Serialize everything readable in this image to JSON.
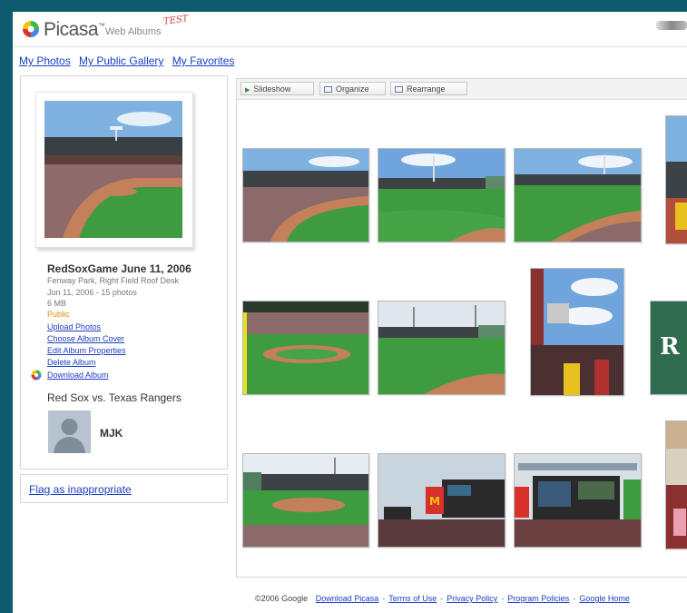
{
  "header": {
    "brand": "Picasa",
    "brand_tm": "™",
    "brand_sub": "Web Albums",
    "badge": "TEST"
  },
  "nav": {
    "my_photos": "My Photos",
    "my_public_gallery": "My Public Gallery",
    "my_favorites": "My Favorites"
  },
  "album": {
    "title": "RedSoxGame June 11, 2006",
    "location": "Fenway Park, Right Field Roof Desk",
    "date_count": "Jun 11, 2006 - 15 photos",
    "size": "6 MB",
    "visibility": "Public",
    "actions": {
      "upload": "Upload Photos",
      "choose_cover": "Choose Album Cover",
      "edit_properties": "Edit Album Properties",
      "delete": "Delete Album",
      "download": "Download Album"
    },
    "description": "Red Sox vs. Texas Rangers",
    "owner": "MJK"
  },
  "flag": {
    "label": "Flag as inappropriate"
  },
  "toolbar": {
    "slideshow": "Slideshow",
    "organize": "Organize",
    "rearrange": "Rearrange"
  },
  "footer": {
    "copyright": "©2006 Google",
    "links": [
      "Download Picasa",
      "Terms of Use",
      "Privacy Policy",
      "Program Policies",
      "Google Home"
    ]
  },
  "colors": {
    "link": "#1a3dc1",
    "public": "#e08a00",
    "page_bg": "#0e5a6e",
    "grass": "#3f9b3f"
  },
  "icons": {
    "slideshow": "play-icon",
    "organize": "organize-icon",
    "rearrange": "rearrange-icon",
    "download": "picasa-icon"
  }
}
